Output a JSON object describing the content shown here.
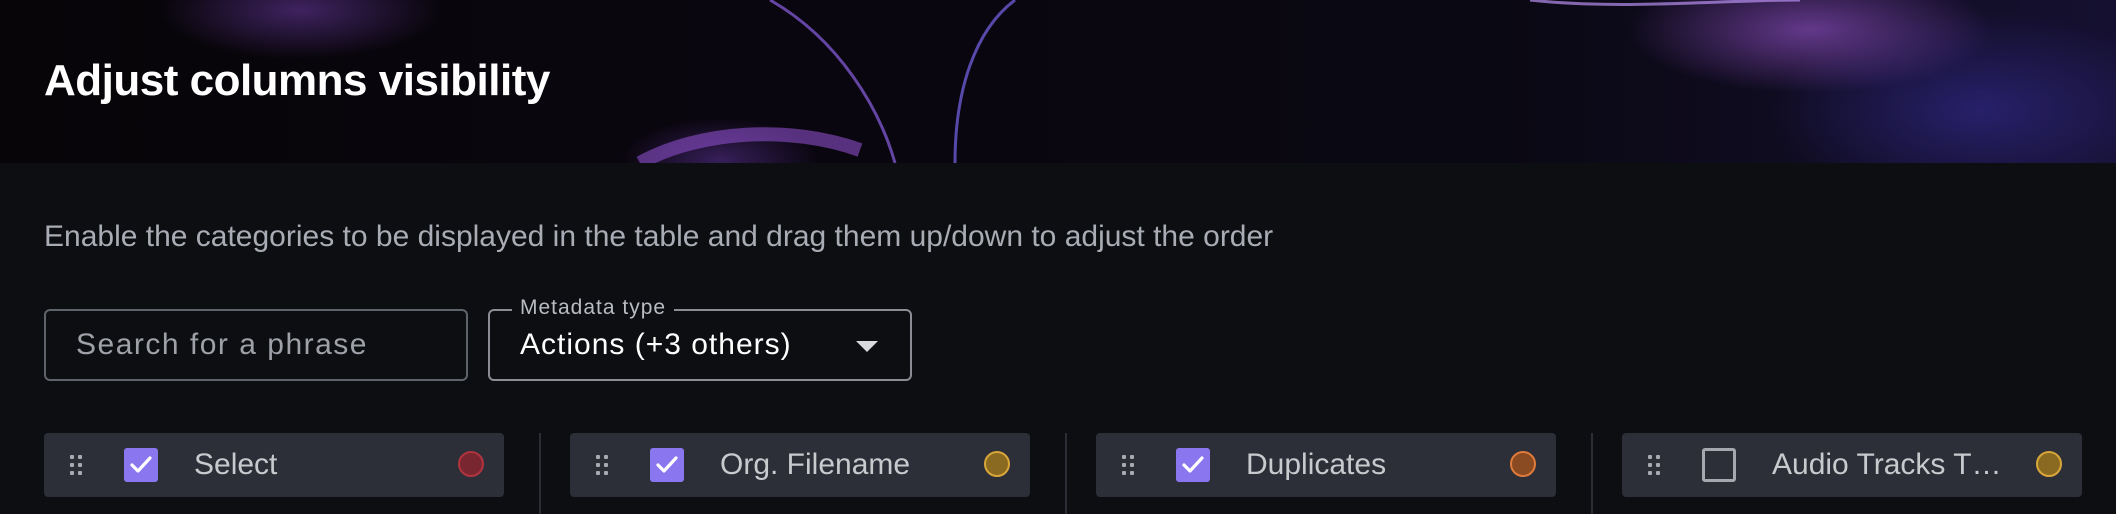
{
  "dialog": {
    "title": "Adjust columns visibility",
    "description": "Enable the categories to be displayed in the table and drag them up/down to adjust the order"
  },
  "search": {
    "placeholder": "Search for a phrase",
    "value": ""
  },
  "metadata_select": {
    "label": "Metadata type",
    "value": "Actions (+3 others)"
  },
  "columns": [
    {
      "label": "Select",
      "checked": true,
      "dot_fill": "#7a2630",
      "dot_border": "#b0343f"
    },
    {
      "label": "Org. Filename",
      "checked": true,
      "dot_fill": "#8a6a20",
      "dot_border": "#d9a63a"
    },
    {
      "label": "Duplicates",
      "checked": true,
      "dot_fill": "#8a4a22",
      "dot_border": "#e07a3a"
    },
    {
      "label": "Audio Tracks T…",
      "checked": false,
      "dot_fill": "#8a6a20",
      "dot_border": "#d9a63a"
    }
  ],
  "colors": {
    "accent": "#8a77f0",
    "background": "#0c0e11",
    "item_background": "#2c2f37"
  }
}
